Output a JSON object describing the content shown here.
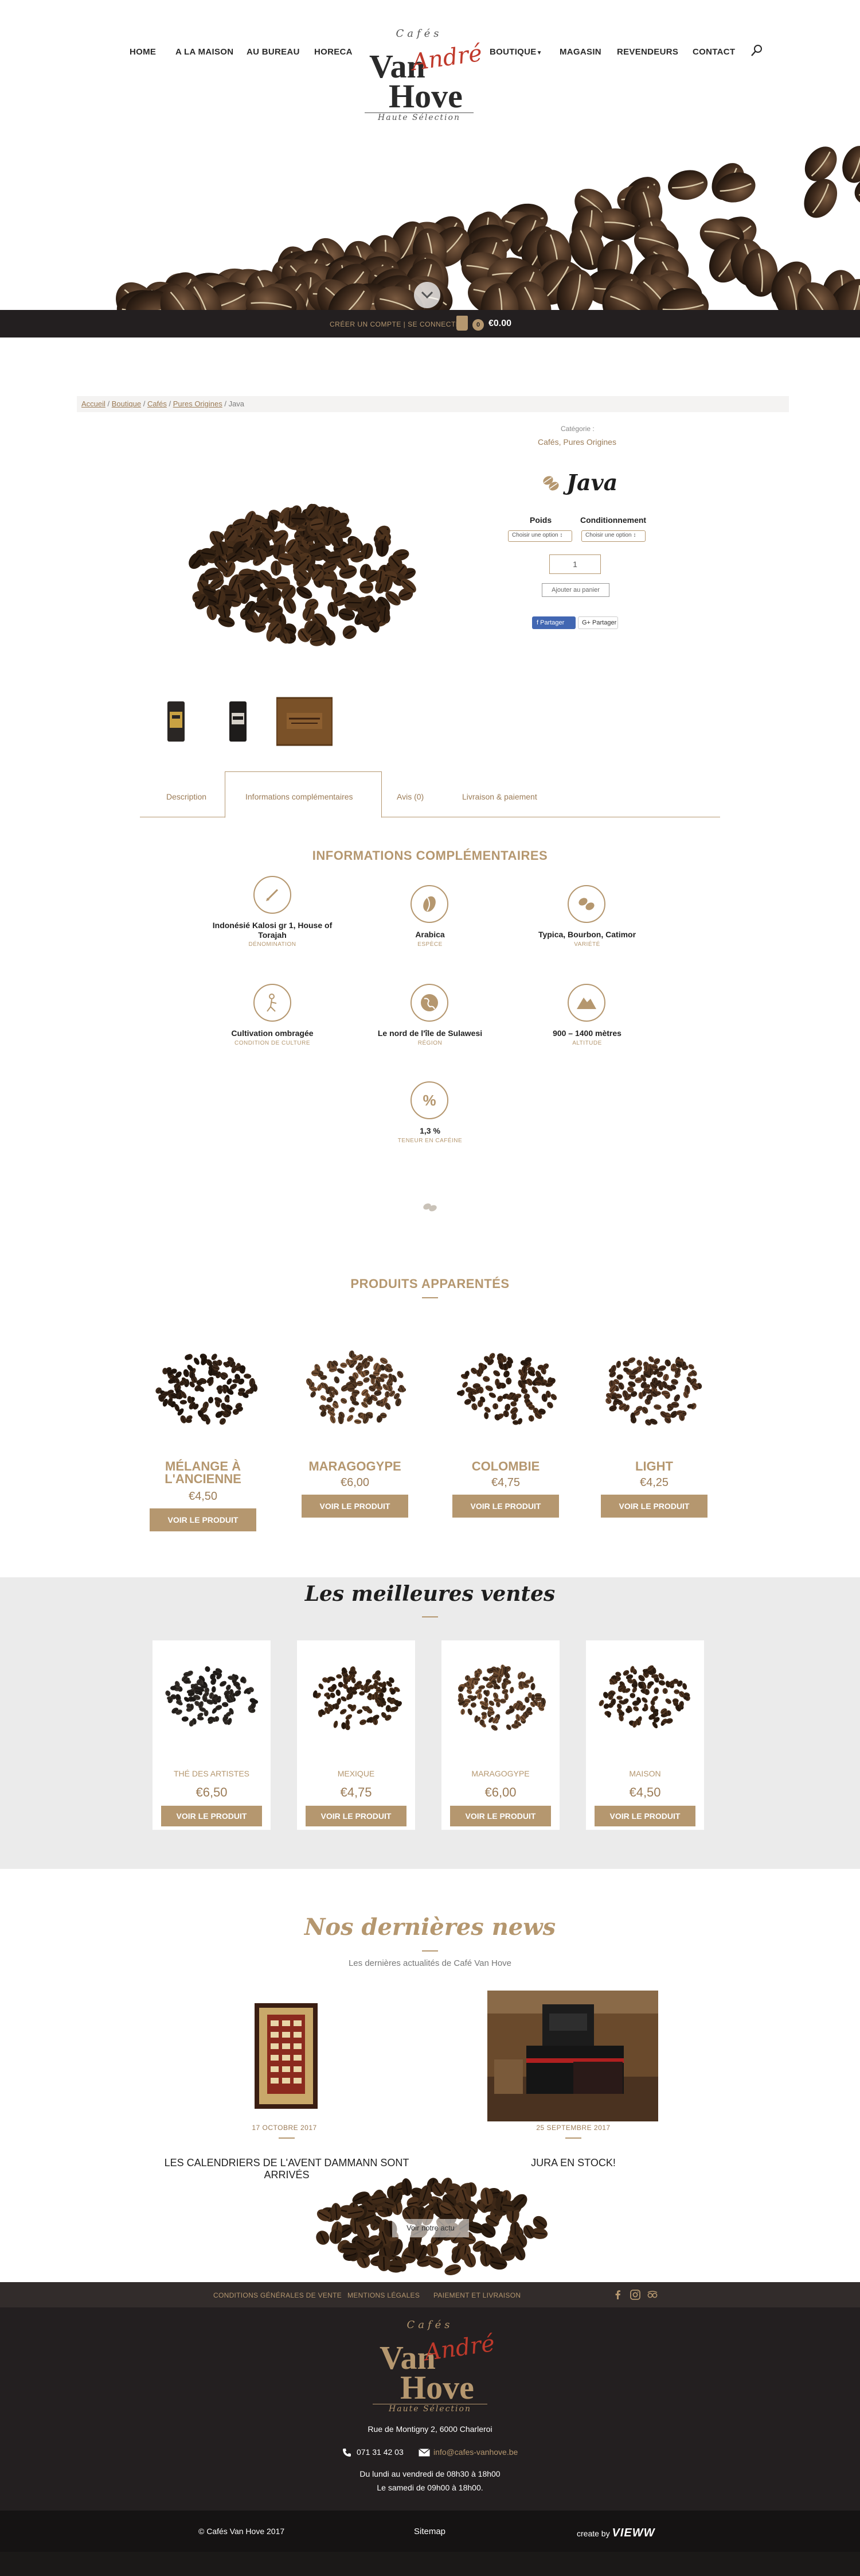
{
  "nav": {
    "home": "HOME",
    "maison": "A LA MAISON",
    "bureau": "AU BUREAU",
    "horeca": "HORECA",
    "boutique": "BOUTIQUE",
    "magasin": "MAGASIN",
    "revendeurs": "REVENDEURS",
    "contact": "CONTACT"
  },
  "logo": {
    "cafes": "Cafés",
    "van": "Van",
    "andre": "André",
    "hove": "Hove",
    "tagline": "Haute Sélection"
  },
  "topbar": {
    "account": "CRÉER UN COMPTE | SE CONNECTER",
    "cart_count": "0",
    "cart_total": "€0.00"
  },
  "breadcrumb": {
    "items": [
      "Accueil",
      "Boutique",
      "Cafés",
      "Pures Origines"
    ],
    "current": "Java",
    "sep": " / "
  },
  "product": {
    "category_label": "Catégorie :",
    "category_value": "Cafés, Pures Origines",
    "title": "Java",
    "weight_label": "Poids",
    "packaging_label": "Conditionnement",
    "weight_select": "Choisir une option ↕",
    "packaging_select": "Choisir une option ↕",
    "quantity": "1",
    "add_to_cart": "Ajouter au panier",
    "fb_share": "f  Partager",
    "gp_share": "G+ Partager"
  },
  "tabs": [
    {
      "label": "Description"
    },
    {
      "label": "Informations complémentaires"
    },
    {
      "label": "Avis (0)"
    },
    {
      "label": "Livraison & paiement"
    }
  ],
  "info": {
    "title": "INFORMATIONS COMPLÉMENTAIRES",
    "features": [
      {
        "icon": "pen-icon",
        "value": "Indonésié Kalosi gr 1, House of Torajah",
        "label": "DÉNOMINATION"
      },
      {
        "icon": "bean-icon",
        "value": "Arabica",
        "label": "ESPÈCE"
      },
      {
        "icon": "beans-icon",
        "value": "Typica, Bourbon, Catimor",
        "label": "VARIÉTÉ"
      },
      {
        "icon": "farmer-icon",
        "value": "Cultivation ombragée",
        "label": "CONDITION DE CULTURE"
      },
      {
        "icon": "globe-icon",
        "value": "Le nord de l'île de Sulawesi",
        "label": "RÉGION"
      },
      {
        "icon": "mountain-icon",
        "value": "900 – 1400 mètres",
        "label": "ALTITUDE"
      },
      {
        "icon": "percent-icon",
        "value": "1,3 %",
        "label": "TENEUR EN CAFÉINE"
      }
    ]
  },
  "related": {
    "title": "PRODUITS APPARENTÉS",
    "items": [
      {
        "name": "MÉLANGE À L'ANCIENNE",
        "price": "€4,50",
        "button": "VOIR LE PRODUIT"
      },
      {
        "name": "MARAGOGYPE",
        "price": "€6,00",
        "button": "VOIR LE PRODUIT"
      },
      {
        "name": "COLOMBIE",
        "price": "€4,75",
        "button": "VOIR LE PRODUIT"
      },
      {
        "name": "LIGHT",
        "price": "€4,25",
        "button": "VOIR LE PRODUIT"
      }
    ]
  },
  "best": {
    "title": "Les meilleures ventes",
    "items": [
      {
        "name": "THÉ DES ARTISTES",
        "price": "€6,50",
        "button": "VOIR LE PRODUIT"
      },
      {
        "name": "MEXIQUE",
        "price": "€4,75",
        "button": "VOIR LE PRODUIT"
      },
      {
        "name": "MARAGOGYPE",
        "price": "€6,00",
        "button": "VOIR LE PRODUIT"
      },
      {
        "name": "MAISON",
        "price": "€4,50",
        "button": "VOIR LE PRODUIT"
      }
    ]
  },
  "news": {
    "title": "Nos dernières news",
    "subtitle": "Les dernières actualités de Café Van Hove",
    "items": [
      {
        "date": "17 OCTOBRE 2017",
        "headline": "LES CALENDRIERS DE L'AVENT DAMMANN SONT ARRIVÉS"
      },
      {
        "date": "25 SEPTEMBRE 2017",
        "headline": "JURA EN STOCK!"
      }
    ],
    "more": "Voir notre actu"
  },
  "footer": {
    "links": [
      "CONDITIONS GÉNÉRALES DE VENTE",
      "MENTIONS LÉGALES",
      "PAIEMENT ET LIVRAISON"
    ],
    "address": "Rue de Montigny 2, 6000 Charleroi",
    "phone": "071 31 42 03",
    "email": "info@cafes-vanhove.be",
    "hours1": "Du lundi au vendredi de 08h30 à 18h00",
    "hours2": "Le samedi de 09h00 à 18h00.",
    "copyright": "© Cafés Van Hove 2017",
    "sitemap": "Sitemap",
    "credit_prefix": "create by",
    "credit_brand": "VIEWW"
  },
  "colors": {
    "accent": "#b5976f",
    "dark": "#231f20",
    "logo_red": "#c0392b"
  }
}
